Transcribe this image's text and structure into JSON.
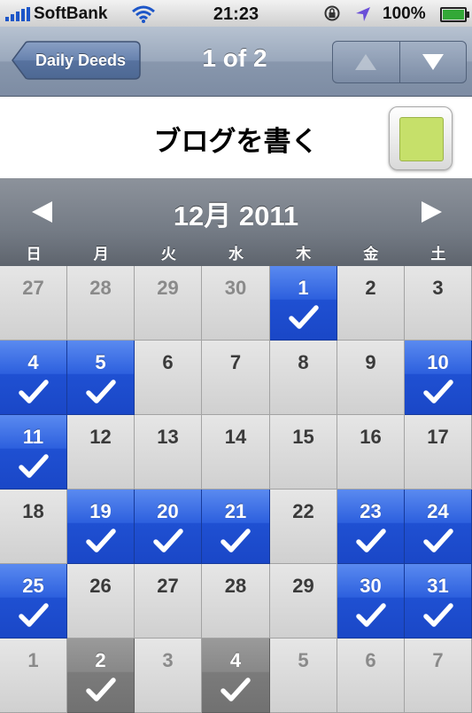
{
  "status": {
    "carrier": "SoftBank",
    "time": "21:23",
    "battery": "100%"
  },
  "nav": {
    "back_label": "Daily Deeds",
    "title": "1 of 2"
  },
  "deed": {
    "title": "ブログを書く",
    "color": "#c6e06a"
  },
  "calendar": {
    "month_label": "12月 2011",
    "weekdays": [
      "日",
      "月",
      "火",
      "水",
      "木",
      "金",
      "土"
    ],
    "weeks": [
      [
        {
          "d": "27",
          "s": "other"
        },
        {
          "d": "28",
          "s": "other"
        },
        {
          "d": "29",
          "s": "other"
        },
        {
          "d": "30",
          "s": "other"
        },
        {
          "d": "1",
          "s": "done"
        },
        {
          "d": "2",
          "s": "normal"
        },
        {
          "d": "3",
          "s": "normal"
        }
      ],
      [
        {
          "d": "4",
          "s": "done"
        },
        {
          "d": "5",
          "s": "done"
        },
        {
          "d": "6",
          "s": "normal"
        },
        {
          "d": "7",
          "s": "normal"
        },
        {
          "d": "8",
          "s": "normal"
        },
        {
          "d": "9",
          "s": "normal"
        },
        {
          "d": "10",
          "s": "done"
        }
      ],
      [
        {
          "d": "11",
          "s": "done"
        },
        {
          "d": "12",
          "s": "normal"
        },
        {
          "d": "13",
          "s": "normal"
        },
        {
          "d": "14",
          "s": "normal"
        },
        {
          "d": "15",
          "s": "normal"
        },
        {
          "d": "16",
          "s": "normal"
        },
        {
          "d": "17",
          "s": "normal"
        }
      ],
      [
        {
          "d": "18",
          "s": "normal"
        },
        {
          "d": "19",
          "s": "done"
        },
        {
          "d": "20",
          "s": "done"
        },
        {
          "d": "21",
          "s": "done"
        },
        {
          "d": "22",
          "s": "normal"
        },
        {
          "d": "23",
          "s": "done"
        },
        {
          "d": "24",
          "s": "done"
        }
      ],
      [
        {
          "d": "25",
          "s": "done"
        },
        {
          "d": "26",
          "s": "normal"
        },
        {
          "d": "27",
          "s": "normal"
        },
        {
          "d": "28",
          "s": "normal"
        },
        {
          "d": "29",
          "s": "normal"
        },
        {
          "d": "30",
          "s": "done"
        },
        {
          "d": "31",
          "s": "done"
        }
      ],
      [
        {
          "d": "1",
          "s": "other"
        },
        {
          "d": "2",
          "s": "other-done"
        },
        {
          "d": "3",
          "s": "other"
        },
        {
          "d": "4",
          "s": "other-done"
        },
        {
          "d": "5",
          "s": "other"
        },
        {
          "d": "6",
          "s": "other"
        },
        {
          "d": "7",
          "s": "other"
        }
      ]
    ]
  },
  "colors": {
    "done": "#2d60de",
    "other_done": "#888888"
  },
  "icons": {
    "wifi": "wifi-icon",
    "lock": "rotation-lock-icon",
    "location": "location-arrow-icon",
    "check": "checkmark-icon",
    "prev": "triangle-left-icon",
    "next": "triangle-right-icon",
    "up": "triangle-up-icon",
    "down": "triangle-down-icon"
  }
}
